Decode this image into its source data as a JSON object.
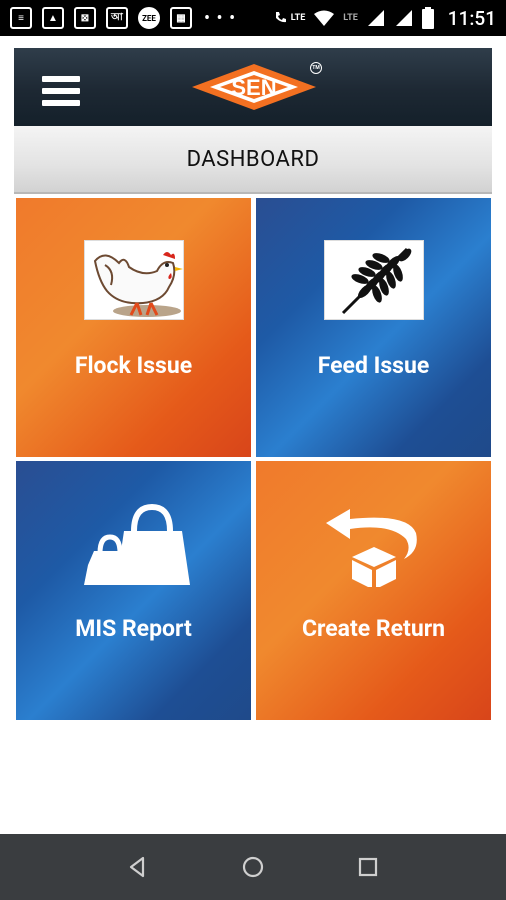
{
  "status_bar": {
    "icons": [
      "notes-icon",
      "sim-icon",
      "pattern-icon",
      "bengali-icon",
      "zee-icon",
      "calendar-icon"
    ],
    "bengali_glyph": "আ",
    "zee_text": "ZEE",
    "more": "• • •",
    "lte1": "LTE",
    "lte2": "LTE",
    "time": "11:51"
  },
  "app_bar": {
    "logo_text": "SEN",
    "tm": "TM"
  },
  "title": "DASHBOARD",
  "tiles": [
    {
      "label": "Flock Issue",
      "icon": "chicken-icon",
      "color": "#f07a2c"
    },
    {
      "label": "Feed Issue",
      "icon": "wheat-icon",
      "color": "#2b7fcf"
    },
    {
      "label": "MIS Report",
      "icon": "shopping-bags-icon",
      "color": "#2b7fcf"
    },
    {
      "label": "Create Return",
      "icon": "return-box-icon",
      "color": "#f07a2c"
    }
  ],
  "colors": {
    "orange": "#f07a2c",
    "blue": "#2b7fcf",
    "appbar": "#1d2833",
    "navbar": "#3a3d40"
  },
  "nav": [
    "back-icon",
    "home-icon",
    "recents-icon"
  ]
}
